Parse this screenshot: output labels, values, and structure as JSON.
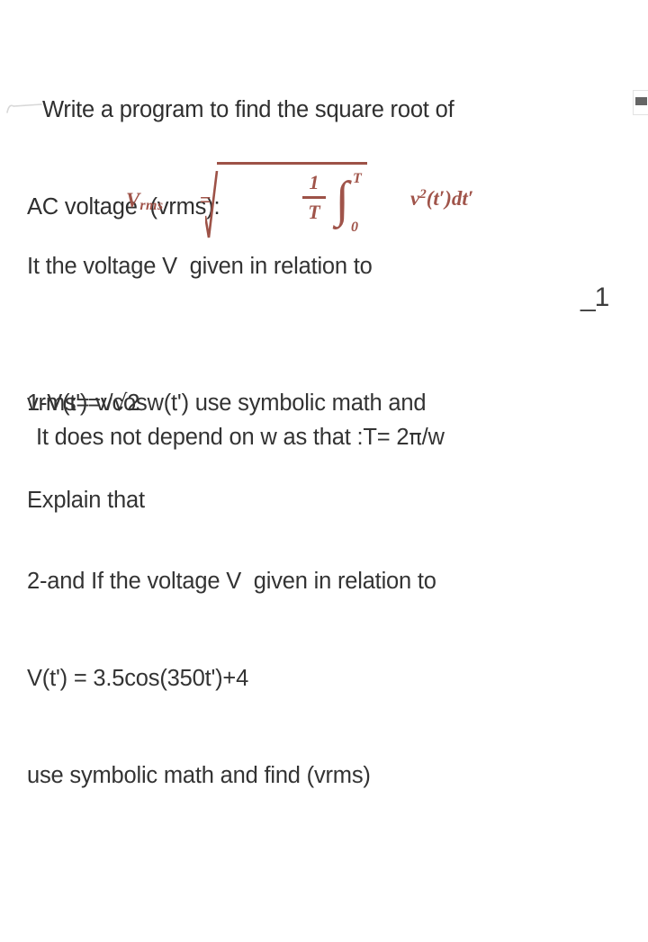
{
  "document": {
    "page_background": "#ffffff",
    "body_text_color": "#333333",
    "formula_color": "#a0544a",
    "heading": {
      "line1": "Write a program to find the square root of",
      "line2": "AC voltage  (vrms):"
    },
    "formula": {
      "lhs_variable": "V",
      "lhs_subscript": "rms",
      "equals": "=",
      "radical_label": "square-root",
      "fraction_numerator": "1",
      "fraction_denominator": "T",
      "integral_symbol": "∫",
      "integral_upper_limit": "T",
      "integral_lower_limit": "0",
      "integrand_base": "v",
      "integrand_exponent": "2",
      "integrand_argument": "(t′)dt′",
      "plain_text": "Vrms = sqrt( (1/T) ∫₀ᵀ v²(t′)dt′ )"
    },
    "line_after_formula": "It the voltage V  given in relation to",
    "margin_annotation": "_1",
    "item_one": {
      "line1": "1-V(t')=vcosw(t') use symbolic math and",
      "line2": "Explain that",
      "line3_prefix": "vrms= v/",
      "line3_sqrt": "√",
      "line3_suffix": "2",
      "line3_plain": "vrms= v/√2",
      "line4_prefix": "It does not depend on w as that :T= 2",
      "line4_pi": "π",
      "line4_suffix": "/w",
      "line4_plain": "It does not depend on w as that :T= 2π/w"
    },
    "item_two": {
      "line1": "2-and If the voltage V  given in relation to",
      "line2": "V(t') = 3.5cos(350t')+4",
      "line3": "use symbolic math and find (vrms)"
    }
  }
}
